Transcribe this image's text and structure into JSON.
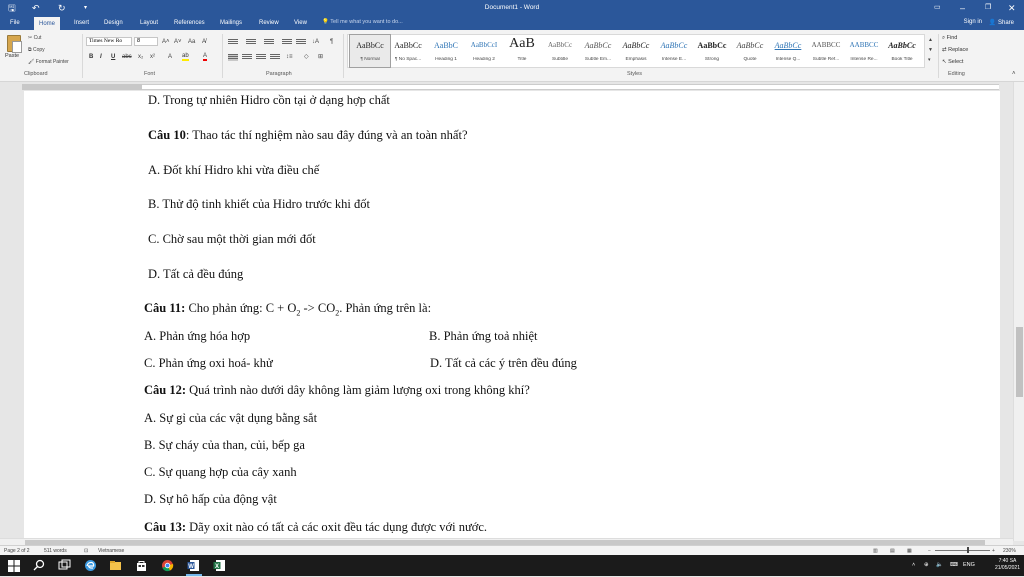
{
  "titlebar": {
    "title": "Document1 - Word",
    "save_icon": "save-icon",
    "undo_icon": "undo-icon",
    "redo_icon": "redo-icon",
    "customize_icon": "dropdown-arrow"
  },
  "tabs": [
    "File",
    "Home",
    "Insert",
    "Design",
    "Layout",
    "References",
    "Mailings",
    "Review",
    "View"
  ],
  "tell_me": "Tell me what you want to do...",
  "account": {
    "signin": "Sign in",
    "share": "Share"
  },
  "ribbon": {
    "clipboard": {
      "paste": "Paste",
      "cut": "Cut",
      "copy": "Copy",
      "format_painter": "Format Painter",
      "label": "Clipboard"
    },
    "font": {
      "name": "Times New Ro",
      "size": "8",
      "label": "Font"
    },
    "paragraph": {
      "label": "Paragraph"
    },
    "styles": {
      "label": "Styles",
      "items": [
        {
          "sample": "AaBbCc",
          "name": "¶ Normal"
        },
        {
          "sample": "AaBbCc",
          "name": "¶ No Spac..."
        },
        {
          "sample": "AaBbC",
          "name": "Heading 1"
        },
        {
          "sample": "AaBbCcI",
          "name": "Heading 2"
        },
        {
          "sample": "AaB",
          "name": "Title"
        },
        {
          "sample": "AaBbCc",
          "name": "Subtitle"
        },
        {
          "sample": "AaBbCc",
          "name": "Subtle Em..."
        },
        {
          "sample": "AaBbCc",
          "name": "Emphasis"
        },
        {
          "sample": "AaBbCc",
          "name": "Intense E..."
        },
        {
          "sample": "AaBbCc",
          "name": "Strong"
        },
        {
          "sample": "AaBbCc",
          "name": "Quote"
        },
        {
          "sample": "AaBbCc",
          "name": "Intense Q..."
        },
        {
          "sample": "AABBCC",
          "name": "Subtle Ref..."
        },
        {
          "sample": "AABBCC",
          "name": "Intense Re..."
        },
        {
          "sample": "AaBbCc",
          "name": "Book Title"
        }
      ]
    },
    "editing": {
      "find": "Find",
      "replace": "Replace",
      "select": "Select",
      "label": "Editing"
    }
  },
  "document": {
    "lines": [
      {
        "text": "D. Trong tự nhiên Hidro cồn tại ở dạng hợp chất"
      },
      {
        "bold": "Câu 10",
        "text": ": Thao tác thí nghiệm nào sau đây đúng và an toàn nhất?"
      },
      {
        "text": "A. Đốt khí Hidro khi vừa điều chế"
      },
      {
        "text": "B. Thử độ tinh khiết của Hidro trước khi đốt"
      },
      {
        "text": "C. Chờ sau một thời gian mới đốt"
      },
      {
        "text": "D. Tất cả đều đúng"
      },
      {
        "bold": "Câu 11:",
        "text": " Cho phản ứng: C + O",
        "sub1": "2",
        "mid": " -> CO",
        "sub2": "2",
        "tail": ". Phản ứng trên là:"
      },
      {
        "text": "A. Phản ứng hóa hợp",
        "right": "B. Phản ứng toả nhiệt"
      },
      {
        "text": "C. Phản ứng oxi hoá- khử",
        "right": "D. Tất cả các ý trên đều đúng"
      },
      {
        "bold": "Câu 12:",
        "text": " Quá trình nào dưới dây không làm giảm lượng oxi trong không khí?"
      },
      {
        "text": "A. Sự gỉ của các vật dụng bằng sắt"
      },
      {
        "text": "B. Sự cháy của than, củi, bếp ga"
      },
      {
        "text": "C. Sự quang hợp của cây xanh"
      },
      {
        "text": "D. Sự hô hấp của động vật"
      },
      {
        "bold": "Câu 13:",
        "text": " Dãy oxit nào có tất cả các oxit đều tác dụng được với nước."
      }
    ]
  },
  "status": {
    "page": "Page 2 of 2",
    "words": "511 words",
    "language": "Vietnamese",
    "zoom": "230%",
    "zoom_level_percent": 230
  },
  "taskbar": {
    "language": "ENG",
    "time": "7:40 SA",
    "date": "21/05/2021"
  },
  "colors": {
    "word_blue": "#2b579a",
    "taskbar": "#1b1b1b"
  }
}
